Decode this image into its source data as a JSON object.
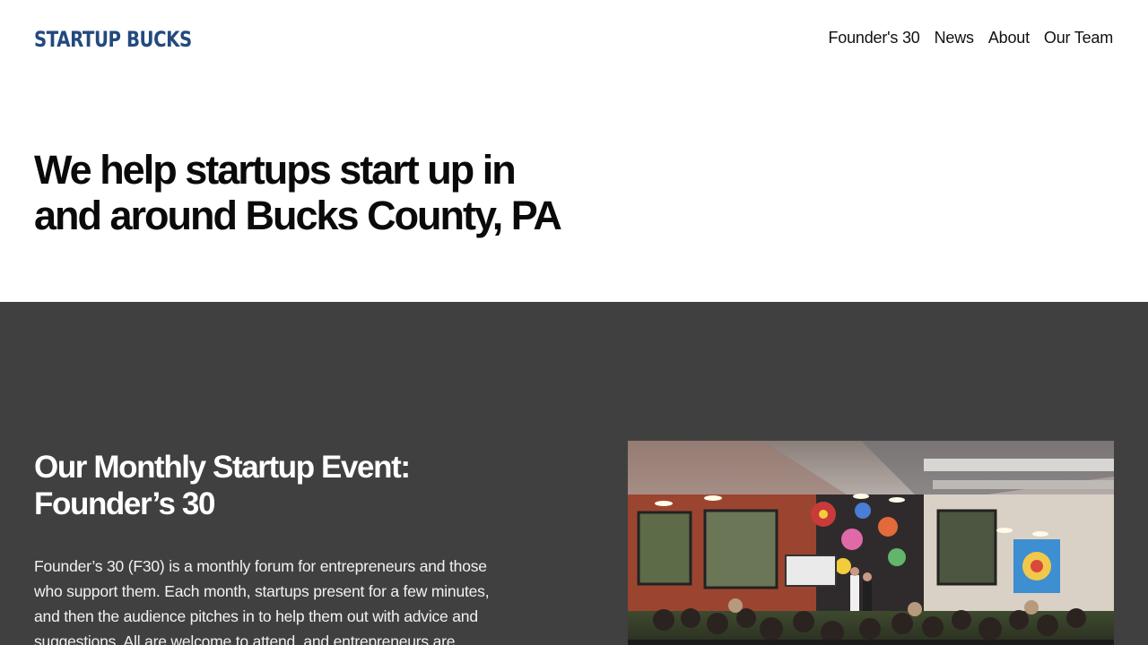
{
  "header": {
    "logo_text": "STARTUP BUCKS",
    "nav": [
      "Founder's 30",
      "News",
      "About",
      "Our Team"
    ]
  },
  "hero": {
    "title": "We help startups start up in and around Bucks County, PA"
  },
  "event": {
    "title": "Our Monthly Startup Event: Founder’s 30",
    "description": "Founder’s 30 (F30) is a monthly forum for entrepreneurs and those who support them. Each month, startups present for a few minutes, and then the audience pitches in to help them out with advice and suggestions. All are welcome to attend, and entrepreneurs are"
  },
  "colors": {
    "brand": "#23497f",
    "section_bg": "#404040"
  }
}
